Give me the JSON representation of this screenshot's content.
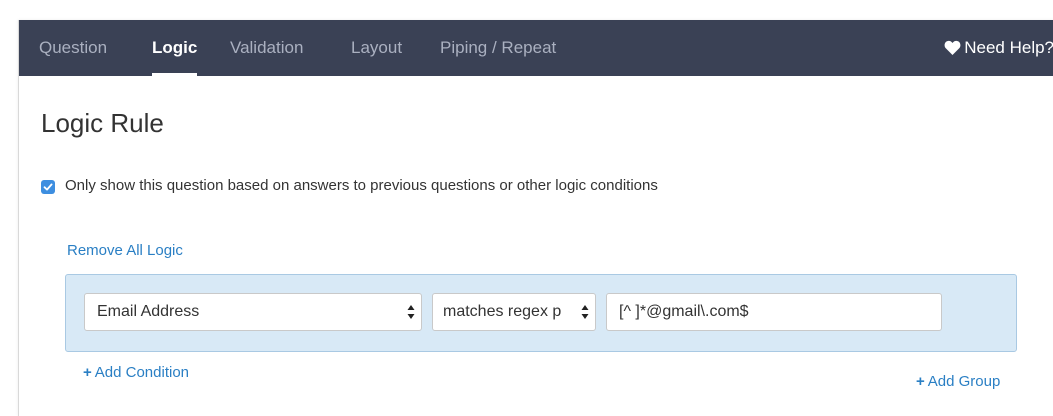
{
  "tabs": [
    {
      "label": "Question",
      "active": false
    },
    {
      "label": "Logic",
      "active": true
    },
    {
      "label": "Validation",
      "active": false
    },
    {
      "label": "Layout",
      "active": false
    },
    {
      "label": "Piping / Repeat",
      "active": false
    }
  ],
  "help": {
    "label": "Need Help?",
    "icon": "heart-icon"
  },
  "page_title": "Logic Rule",
  "logic_toggle": {
    "checked": true,
    "label": "Only show this question based on answers to previous questions or other logic conditions"
  },
  "remove_all_label": "Remove All Logic",
  "condition": {
    "field_value": "Email Address",
    "operator_value": "matches regex p",
    "input_value": "[^ ]*@gmail\\.com$"
  },
  "add_condition_label": "Add Condition",
  "add_group_label": "Add Group",
  "colors": {
    "tabbar_bg": "#3a4155",
    "link": "#2a7fc4",
    "rule_bg": "#d8e9f6",
    "checkbox": "#3d8ee0"
  }
}
